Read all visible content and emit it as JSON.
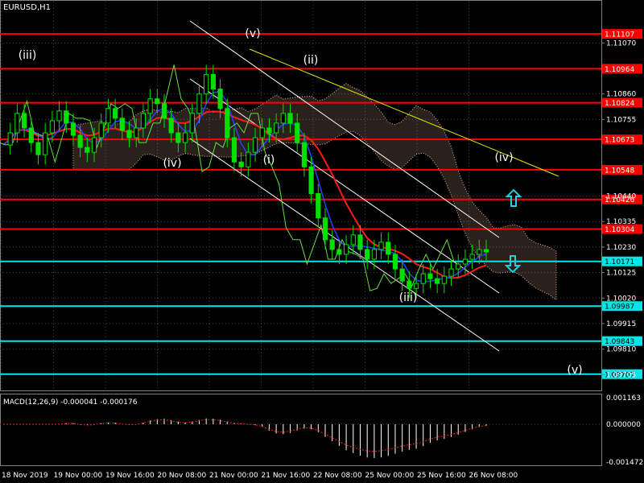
{
  "window": {
    "symbol_title": "EURUSD,H1"
  },
  "macd": {
    "label": "MACD(12,26,9) -0.000041 -0.000176",
    "axis_labels": [
      "0.001163",
      "0.000000",
      "-0.001472"
    ]
  },
  "chart_data": {
    "type": "candlestick",
    "title": "EURUSD,H1",
    "ylim": [
      1.0964,
      1.1124
    ],
    "y_ticks": [
      1.1107,
      1.1086,
      1.10755,
      1.1044,
      1.10335,
      1.1023,
      1.10125,
      1.1002,
      1.09915,
      1.0981,
      1.09705
    ],
    "y_tick_labels": [
      "1.11070",
      "1.10860",
      "1.10755",
      "1.10440",
      "1.10335",
      "1.10230",
      "1.10125",
      "1.10020",
      "1.09915",
      "1.09810",
      "1.09705"
    ],
    "x_tick_labels": [
      "18 Nov 2019",
      "19 Nov 00:00",
      "19 Nov 16:00",
      "20 Nov 08:00",
      "21 Nov 00:00",
      "21 Nov 16:00",
      "22 Nov 08:00",
      "25 Nov 00:00",
      "25 Nov 16:00",
      "26 Nov 08:00"
    ],
    "levels": [
      {
        "label": "1.11107",
        "value": 1.11107,
        "color": "#ff0000"
      },
      {
        "label": "1.10964",
        "value": 1.10964,
        "color": "#ff0000"
      },
      {
        "label": "1.10824",
        "value": 1.10824,
        "color": "#ff0000"
      },
      {
        "label": "1.10673",
        "value": 1.10673,
        "color": "#ff0000"
      },
      {
        "label": "1.10548",
        "value": 1.10548,
        "color": "#ff0000"
      },
      {
        "label": "1.10426",
        "value": 1.10426,
        "color": "#ff0000"
      },
      {
        "label": "1.10304",
        "value": 1.10304,
        "color": "#ff0000"
      },
      {
        "label": "1.10171",
        "value": 1.10171,
        "color": "#00e5e5"
      },
      {
        "label": "1.09987",
        "value": 1.09987,
        "color": "#00e5e5"
      },
      {
        "label": "1.09843",
        "value": 1.09843,
        "color": "#00e5e5"
      },
      {
        "label": "1.09707",
        "value": 1.09707,
        "color": "#00e5e5"
      }
    ],
    "wave_labels": [
      "(iii)",
      "(iv)",
      "(v)",
      "(i)",
      "(ii)",
      "(iii)",
      "(iv)",
      "(v)"
    ],
    "price_series": [
      1.1065,
      1.107,
      1.1078,
      1.1072,
      1.1066,
      1.1061,
      1.107,
      1.1075,
      1.1079,
      1.1074,
      1.1069,
      1.1064,
      1.1062,
      1.1068,
      1.1074,
      1.108,
      1.1076,
      1.1071,
      1.1068,
      1.1072,
      1.1078,
      1.1084,
      1.1082,
      1.1076,
      1.107,
      1.1066,
      1.107,
      1.1078,
      1.1086,
      1.1094,
      1.1088,
      1.108,
      1.1068,
      1.1058,
      1.1056,
      1.1062,
      1.1068,
      1.1072,
      1.107,
      1.1074,
      1.1078,
      1.1074,
      1.1066,
      1.1056,
      1.1045,
      1.1035,
      1.1026,
      1.1022,
      1.102,
      1.1024,
      1.1028,
      1.1022,
      1.1018,
      1.1022,
      1.1025,
      1.102,
      1.1014,
      1.1009,
      1.1006,
      1.1008,
      1.1012,
      1.101,
      1.1008,
      1.1011,
      1.1014,
      1.1016,
      1.1018,
      1.102,
      1.1022,
      1.1021
    ],
    "colors": {
      "background": "#000000",
      "candles": "#00e000",
      "chikou": "#66dd44",
      "kijun": "#ff1a1a",
      "tenkan": "#2244ff",
      "cloud": "#e8b89a",
      "channel": "#ffffff",
      "resistance_trendline": "#e6e600",
      "arrows": "#22cfe0",
      "grid": "#444444"
    }
  }
}
